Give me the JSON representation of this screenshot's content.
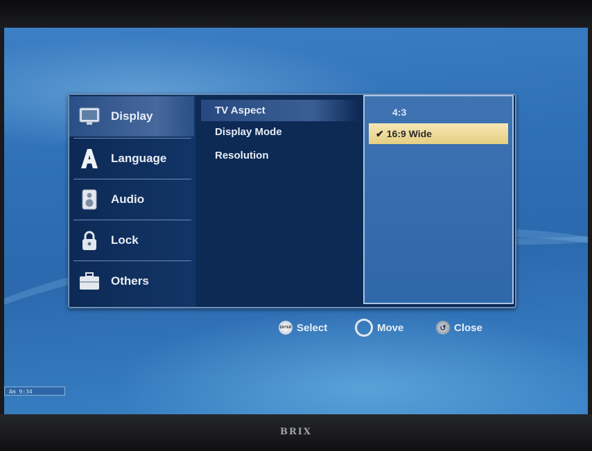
{
  "brand": "BRIX",
  "clock": "Am 9:34",
  "categories": [
    {
      "label": "Display",
      "icon": "display-icon",
      "active": true
    },
    {
      "label": "Language",
      "icon": "language-icon",
      "active": false
    },
    {
      "label": "Audio",
      "icon": "audio-speaker-icon",
      "active": false
    },
    {
      "label": "Lock",
      "icon": "lock-icon",
      "active": false
    },
    {
      "label": "Others",
      "icon": "toolbox-icon",
      "active": false
    }
  ],
  "options": [
    {
      "label": "TV Aspect",
      "active": true
    },
    {
      "label": "Display Mode",
      "active": false
    },
    {
      "label": "Resolution",
      "active": false
    }
  ],
  "values": [
    {
      "label": "4:3",
      "selected": false
    },
    {
      "label": "16:9 Wide",
      "selected": true
    }
  ],
  "help": {
    "select_label": "Select",
    "move_label": "Move",
    "close_label": "Close",
    "enter_icon_text": "ENTER"
  },
  "colors": {
    "panel": "#0d2a55",
    "selection_highlight": "#efdb98",
    "screen_blue": "#2e6fb6"
  }
}
